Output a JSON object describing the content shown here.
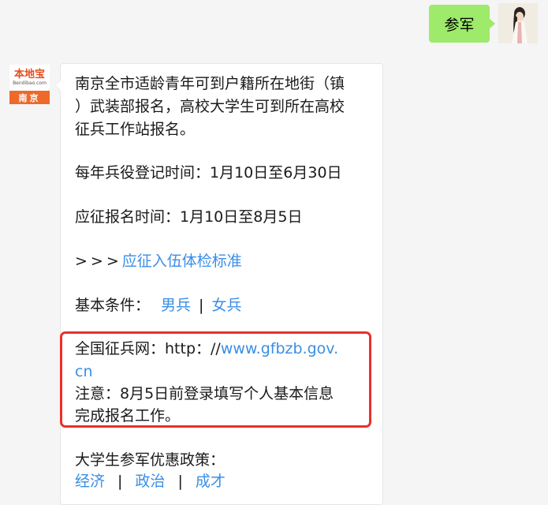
{
  "user_message": {
    "text": "参军"
  },
  "bot_avatar": {
    "logo_main": "本地宝",
    "logo_sub": "Bendibao.com",
    "logo_city": "南京"
  },
  "bot_message": {
    "intro_lines": [
      "南京全市适龄青年可到户籍所在地街（镇",
      "）武装部报名，高校大学生可到所在高校",
      "征兵工作站报名。"
    ],
    "registration_time": "每年兵役登记时间：1月10日至6月30日",
    "application_time": "应征报名时间：1月10日至8月5日",
    "standard_prefix": ">>>",
    "standard_link": "应征入伍体检标准",
    "basic_conditions_label": "基本条件：",
    "basic_conditions_links": [
      "男兵",
      "女兵"
    ],
    "separator": "|",
    "website_label": "全国征兵网：http：//",
    "website_link_line1": "www.gfbzb.gov.",
    "website_link_line2": "cn",
    "notice_line1": "注意：8月5日前登录填写个人基本信息",
    "notice_line2": "完成报名工作。",
    "policy_label": "大学生参军优惠政策：",
    "policy_links": [
      "经济",
      "政治",
      "成才"
    ]
  },
  "colors": {
    "user_bubble": "#9eea6a",
    "link": "#3a8ee6",
    "highlight_border": "#e8312a",
    "logo_orange": "#ee6a2b"
  }
}
